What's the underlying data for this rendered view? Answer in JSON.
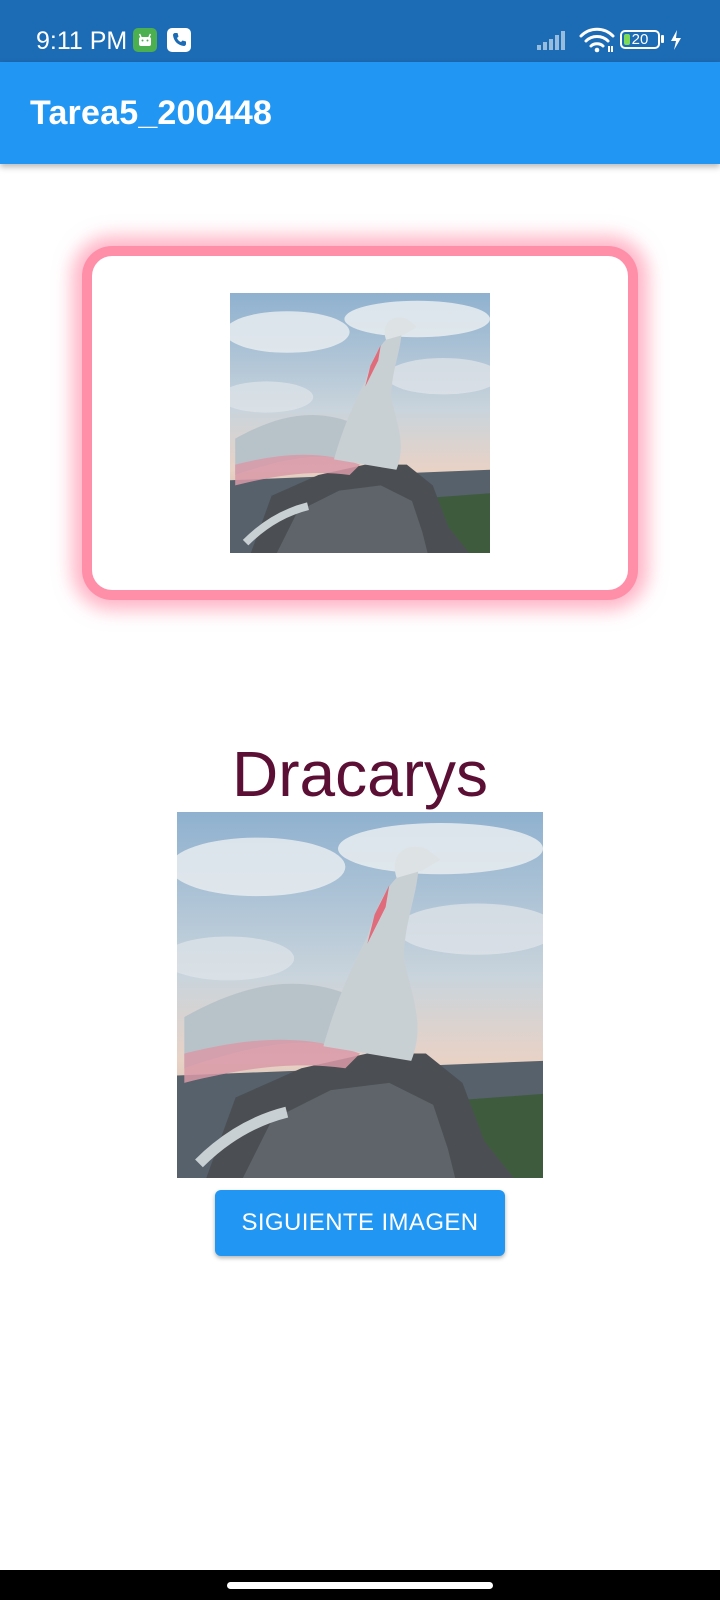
{
  "status_bar": {
    "time": "9:11 PM",
    "battery_level": "20",
    "notification_icons": [
      "android-notification-icon",
      "phone-notification-icon"
    ],
    "colors": {
      "background": "#1c6bb5"
    }
  },
  "app_bar": {
    "title": "Tarea5_200448",
    "colors": {
      "background": "#2196f3"
    }
  },
  "card": {
    "image_icon": "dragon-image",
    "colors": {
      "glow": "#ff8fa8"
    }
  },
  "main": {
    "title": "Dracarys",
    "image_icon": "dragon-image",
    "colors": {
      "title": "#5c0f35"
    }
  },
  "button": {
    "label": "SIGUIENTE IMAGEN",
    "colors": {
      "background": "#2196f3",
      "text": "#ffffff"
    }
  }
}
